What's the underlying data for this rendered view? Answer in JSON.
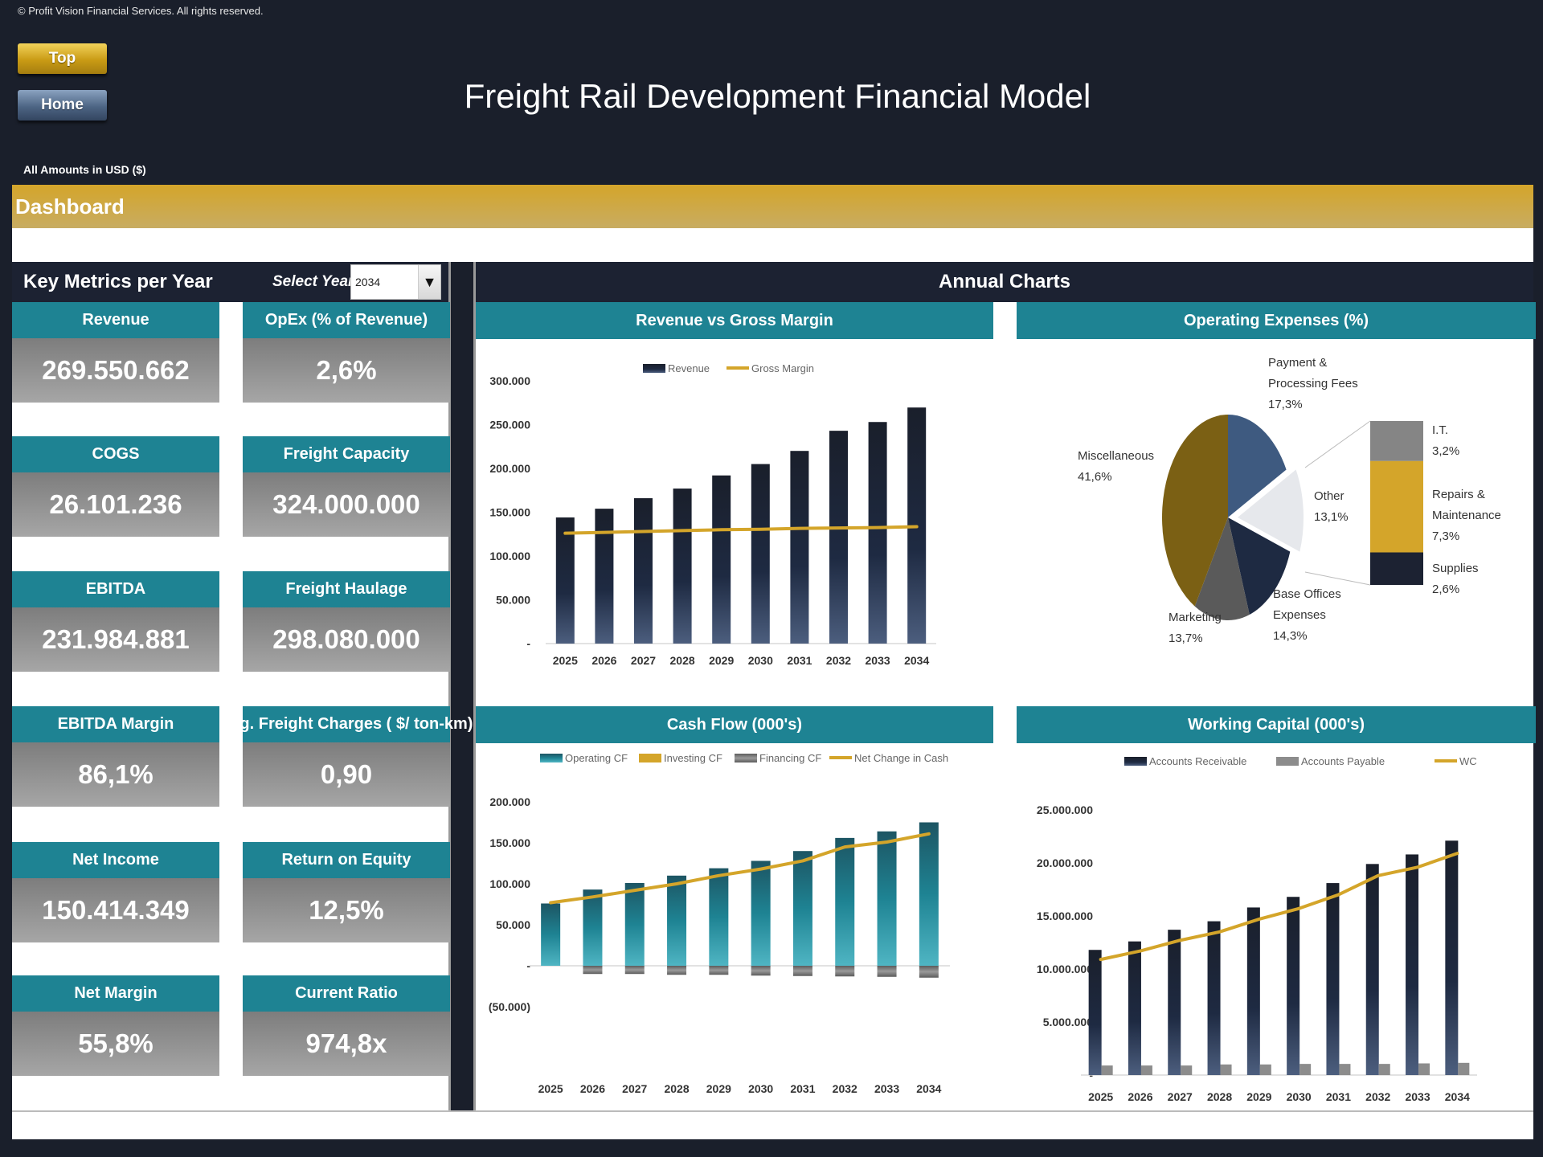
{
  "copyright": "© Profit Vision Financial Services. All rights reserved.",
  "nav": {
    "top_label": "Top",
    "home_label": "Home"
  },
  "title": "Freight Rail Development Financial Model",
  "amounts_label": "All Amounts in  USD ($)",
  "section_label": "Dashboard",
  "key_metrics": {
    "title": "Key Metrics per Year",
    "select_label": "Select Year",
    "selected_year": "2034",
    "cards": [
      {
        "label": "Revenue",
        "value": "269.550.662"
      },
      {
        "label": "OpEx (% of Revenue)",
        "value": "2,6%"
      },
      {
        "label": "COGS",
        "value": "26.101.236"
      },
      {
        "label": "Freight Capacity",
        "value": "324.000.000"
      },
      {
        "label": "EBITDA",
        "value": "231.984.881"
      },
      {
        "label": "Freight Haulage",
        "value": "298.080.000"
      },
      {
        "label": "EBITDA Margin",
        "value": "86,1%"
      },
      {
        "label": "Avg. Freight Charges ( $/ ton-km)",
        "value": "0,90"
      },
      {
        "label": "Net Income",
        "value": "150.414.349"
      },
      {
        "label": "Return on Equity",
        "value": "12,5%"
      },
      {
        "label": "Net Margin",
        "value": "55,8%"
      },
      {
        "label": "Current Ratio",
        "value": "974,8x"
      }
    ]
  },
  "charts_title": "Annual Charts",
  "colors": {
    "navy": "#1c2232",
    "teal": "#1e8393",
    "gold": "#d4a52a",
    "gray": "#808080"
  },
  "chart_data": [
    {
      "id": "rev",
      "type": "bar",
      "title": "Revenue vs Gross Margin",
      "categories": [
        "2025",
        "2026",
        "2027",
        "2028",
        "2029",
        "2030",
        "2031",
        "2032",
        "2033",
        "2034"
      ],
      "series": [
        {
          "name": "Revenue",
          "kind": "bar",
          "values": [
            144000,
            154000,
            166000,
            177000,
            192000,
            205000,
            220000,
            243000,
            253000,
            269550
          ]
        },
        {
          "name": "Gross Margin",
          "kind": "line",
          "values": [
            126000,
            127000,
            128000,
            129000,
            130000,
            130500,
            131500,
            132000,
            132500,
            133500
          ]
        }
      ],
      "yticks": [
        "-",
        "50.000",
        "100.000",
        "150.000",
        "200.000",
        "250.000",
        "300.000"
      ],
      "ylim": [
        0,
        300000
      ]
    },
    {
      "id": "opex",
      "type": "pie",
      "title": "Operating Expenses (%)",
      "slices": [
        {
          "name": "Payment & Processing Fees",
          "value": 17.3,
          "label": "17,3%"
        },
        {
          "name": "Other",
          "value": 13.1,
          "label": "13,1%"
        },
        {
          "name": "Base Offices Expenses",
          "value": 14.3,
          "label": "14,3%"
        },
        {
          "name": "Marketing",
          "value": 13.7,
          "label": "13,7%"
        },
        {
          "name": "Miscellaneous",
          "value": 41.6,
          "label": "41,6%"
        }
      ],
      "other_breakdown": [
        {
          "name": "I.T.",
          "value": 3.2,
          "label": "3,2%"
        },
        {
          "name": "Repairs & Maintenance",
          "value": 7.3,
          "label": "7,3%"
        },
        {
          "name": "Supplies",
          "value": 2.6,
          "label": "2,6%"
        }
      ]
    },
    {
      "id": "cf",
      "type": "bar",
      "title": "Cash Flow (000's)",
      "categories": [
        "2025",
        "2026",
        "2027",
        "2028",
        "2029",
        "2030",
        "2031",
        "2032",
        "2033",
        "2034"
      ],
      "series": [
        {
          "name": "Operating CF",
          "kind": "bar",
          "values": [
            76000,
            93000,
            101000,
            110000,
            119000,
            128000,
            140000,
            156000,
            164000,
            175000
          ]
        },
        {
          "name": "Investing CF",
          "kind": "bar",
          "values": [
            0,
            0,
            0,
            0,
            0,
            0,
            0,
            0,
            0,
            0
          ]
        },
        {
          "name": "Financing CF",
          "kind": "bar",
          "values": [
            0,
            -10000,
            -10000,
            -11000,
            -11000,
            -12000,
            -12500,
            -13000,
            -13500,
            -14500
          ]
        },
        {
          "name": "Net Change in Cash",
          "kind": "line",
          "values": [
            77000,
            84000,
            92000,
            100000,
            110000,
            118000,
            128000,
            145000,
            151000,
            161000
          ]
        }
      ],
      "yticks": [
        "(50.000)",
        "-",
        "50.000",
        "100.000",
        "150.000",
        "200.000"
      ],
      "ylim": [
        -50000,
        200000
      ]
    },
    {
      "id": "wc",
      "type": "bar",
      "title": "Working Capital (000's)",
      "categories": [
        "2025",
        "2026",
        "2027",
        "2028",
        "2029",
        "2030",
        "2031",
        "2032",
        "2033",
        "2034"
      ],
      "series": [
        {
          "name": "Accounts Receivable",
          "kind": "bar",
          "values": [
            11800000,
            12600000,
            13700000,
            14500000,
            15800000,
            16800000,
            18100000,
            19900000,
            20800000,
            22100000
          ]
        },
        {
          "name": "Accounts Payable",
          "kind": "bar",
          "values": [
            900000,
            900000,
            900000,
            1000000,
            1000000,
            1050000,
            1050000,
            1050000,
            1100000,
            1150000
          ]
        },
        {
          "name": "WC",
          "kind": "line",
          "values": [
            10900000,
            11700000,
            12700000,
            13500000,
            14700000,
            15700000,
            17000000,
            18800000,
            19600000,
            20900000
          ]
        }
      ],
      "yticks": [
        "-",
        "5.000.000",
        "10.000.000",
        "15.000.000",
        "20.000.000",
        "25.000.000"
      ],
      "ylim": [
        0,
        25000000
      ]
    }
  ]
}
